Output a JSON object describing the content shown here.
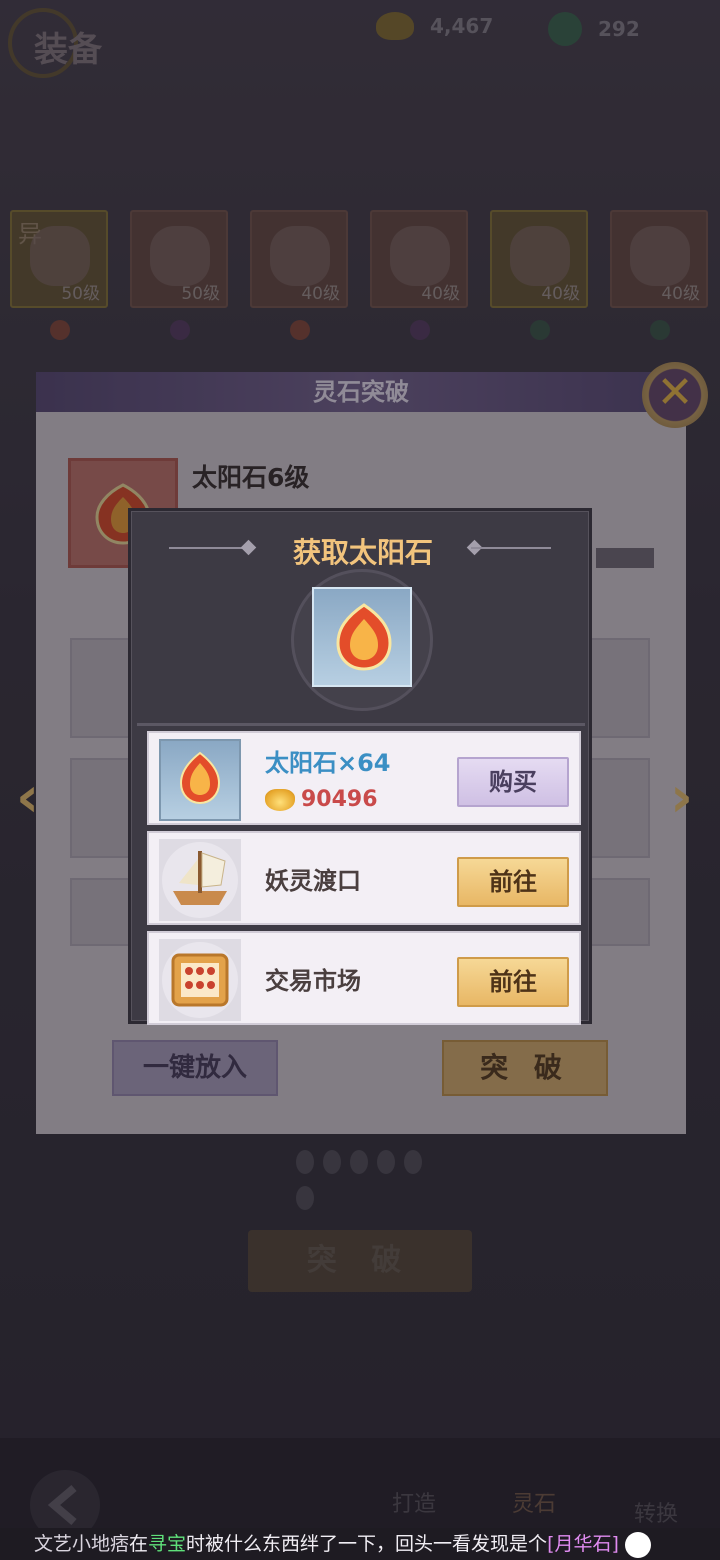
{
  "topbar": {
    "title": "装备",
    "currency": [
      {
        "icon": "gold-ingot-icon",
        "value": "4,467"
      },
      {
        "icon": "jade-coin-icon",
        "value": "292"
      }
    ]
  },
  "equipment": {
    "tag": "异",
    "slots": [
      {
        "icon": "sword-icon",
        "level": "50级"
      },
      {
        "icon": "bracelet-icon",
        "level": "50级"
      },
      {
        "icon": "helmet-icon",
        "level": "40级"
      },
      {
        "icon": "robe-icon",
        "level": "40级"
      },
      {
        "icon": "ring-icon",
        "level": "40级"
      },
      {
        "icon": "boots-icon",
        "level": "40级"
      }
    ]
  },
  "panel": {
    "title": "灵石突破",
    "stone_name": "太阳石6级",
    "auto_fill_label": "一键放入",
    "break_label": "突 破"
  },
  "background": {
    "break_label": "突 破"
  },
  "popup": {
    "title": "获取太阳石",
    "sources": [
      {
        "icon": "sun-stone-icon",
        "name": "太阳石×64",
        "price": "90496",
        "button": "购买"
      },
      {
        "icon": "ship-icon",
        "name": "妖灵渡口",
        "button": "前往"
      },
      {
        "icon": "abacus-icon",
        "name": "交易市场",
        "button": "前往"
      }
    ]
  },
  "bottom_nav": {
    "items": [
      "打造",
      "灵石",
      "转换"
    ]
  },
  "ticker": {
    "player": "文艺小地痞",
    "text_1": "在",
    "place": "寻宝",
    "text_2": "时被什么东西绊了一下，回头一看发现是个",
    "item": "[月华石]"
  },
  "colors": {
    "popup_title": "#f2c47d",
    "price": "#c94a4a",
    "stone_name": "#3b8fc4",
    "highlight": "#5fe07a",
    "item": "#e08bf0"
  }
}
